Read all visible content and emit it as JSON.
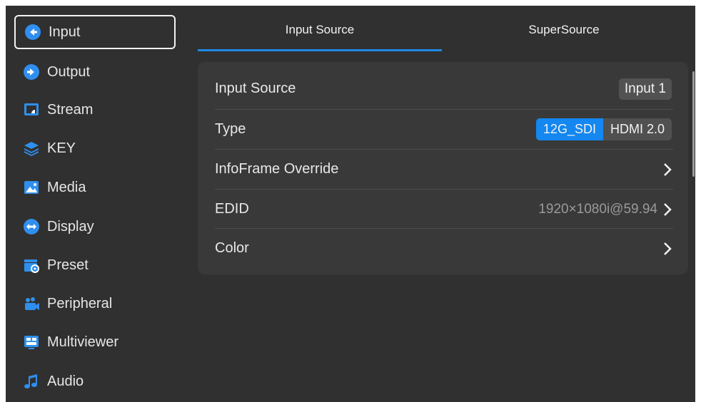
{
  "sidebar": {
    "items": [
      {
        "label": "Input",
        "icon": "input-icon",
        "active": true
      },
      {
        "label": "Output",
        "icon": "output-icon"
      },
      {
        "label": "Stream",
        "icon": "stream-icon"
      },
      {
        "label": "KEY",
        "icon": "key-layers-icon"
      },
      {
        "label": "Media",
        "icon": "media-image-icon"
      },
      {
        "label": "Display",
        "icon": "display-icon"
      },
      {
        "label": "Preset",
        "icon": "preset-icon"
      },
      {
        "label": "Peripheral",
        "icon": "peripheral-icon"
      },
      {
        "label": "Multiviewer",
        "icon": "multiviewer-icon"
      },
      {
        "label": "Audio",
        "icon": "audio-music-icon"
      }
    ]
  },
  "tabs": [
    {
      "label": "Input Source",
      "active": true
    },
    {
      "label": "SuperSource",
      "active": false
    }
  ],
  "settings": {
    "input_source": {
      "label": "Input Source",
      "value": "Input 1"
    },
    "type": {
      "label": "Type",
      "options": [
        "12G_SDI",
        "HDMI 2.0"
      ],
      "selected": "12G_SDI"
    },
    "infoframe": {
      "label": "InfoFrame Override"
    },
    "edid": {
      "label": "EDID",
      "value": "1920×1080i@59.94"
    },
    "color": {
      "label": "Color"
    }
  },
  "colors": {
    "background": "#303030",
    "panel": "#393939",
    "accent": "#1487f0",
    "icon_blue": "#2f8fef"
  }
}
